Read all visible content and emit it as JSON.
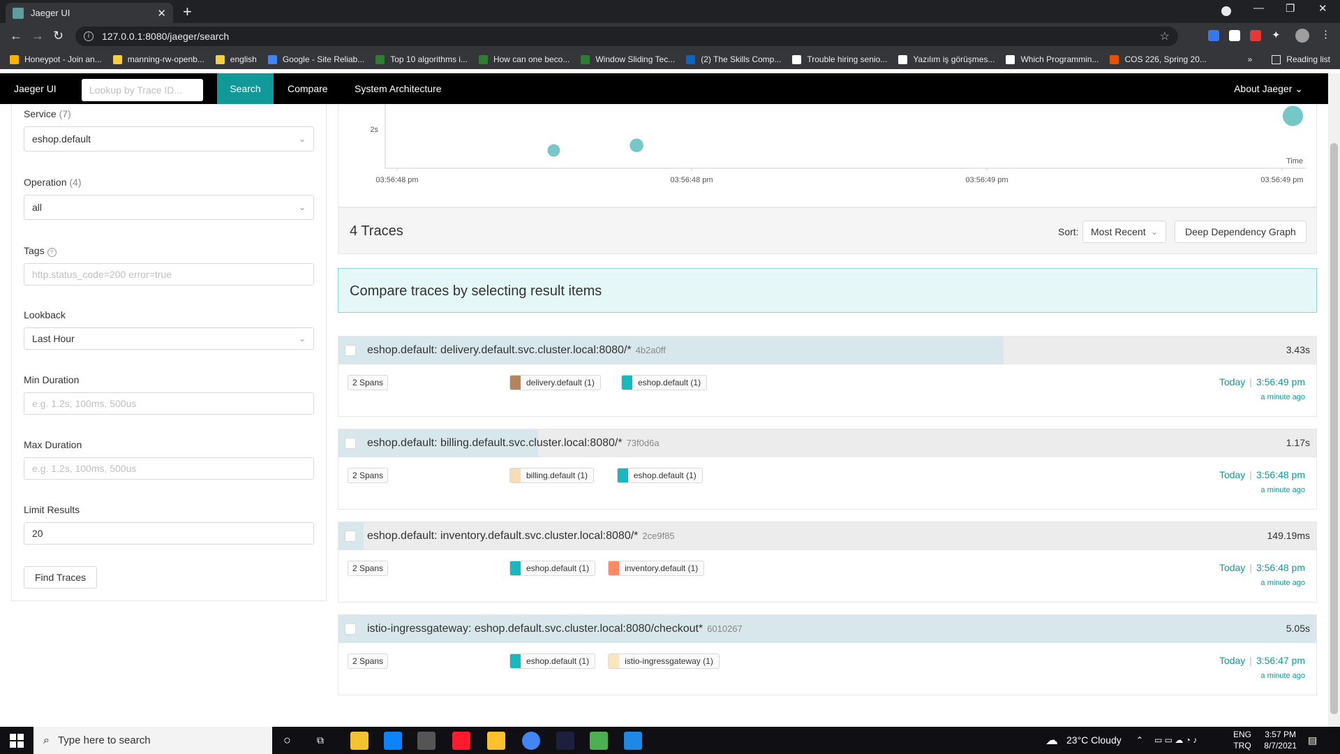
{
  "browser": {
    "tab_title": "Jaeger UI",
    "tab_close": "✕",
    "new_tab": "+",
    "url": "127.0.0.1:8080/jaeger/search",
    "window_controls": [
      "—",
      "❐",
      "✕"
    ],
    "bookmarks": [
      {
        "label": "Honeypot - Join an...",
        "color": "#f4b400"
      },
      {
        "label": "manning-rw-openb...",
        "color": "#f4d03f"
      },
      {
        "label": "english",
        "color": "#f4d03f"
      },
      {
        "label": "Google - Site Reliab...",
        "color": "#4285f4"
      },
      {
        "label": "Top 10 algorithms i...",
        "color": "#2e7d32"
      },
      {
        "label": "How can one beco...",
        "color": "#2e7d32"
      },
      {
        "label": "Window Sliding Tec...",
        "color": "#2e7d32"
      },
      {
        "label": "(2) The Skills Comp...",
        "color": "#0a66c2"
      },
      {
        "label": "Trouble hiring senio...",
        "color": "#ffffff"
      },
      {
        "label": "Yazılım iş görüşmes...",
        "color": "#ffffff"
      },
      {
        "label": "Which Programmin...",
        "color": "#ffffff"
      },
      {
        "label": "COS 226, Spring 20...",
        "color": "#e65100"
      }
    ],
    "bookmarks_more": "»",
    "reading_list": "Reading list"
  },
  "jaeger_nav": {
    "brand": "Jaeger UI",
    "lookup_placeholder": "Lookup by Trace ID...",
    "items": [
      "Search",
      "Compare",
      "System Architecture"
    ],
    "about": "About Jaeger ⌄"
  },
  "search_form": {
    "service_label": "Service",
    "service_count": "(7)",
    "service_value": "eshop.default",
    "operation_label": "Operation",
    "operation_count": "(4)",
    "operation_value": "all",
    "tags_label": "Tags",
    "tags_placeholder": "http.status_code=200 error=true",
    "lookback_label": "Lookback",
    "lookback_value": "Last Hour",
    "min_duration_label": "Min Duration",
    "min_duration_placeholder": "e.g. 1.2s, 100ms, 500us",
    "max_duration_label": "Max Duration",
    "max_duration_placeholder": "e.g. 1.2s, 100ms, 500us",
    "limit_label": "Limit Results",
    "limit_value": "20",
    "find_button": "Find Traces"
  },
  "chart_data": {
    "type": "scatter",
    "ytick": "2s",
    "xlabel": "Time",
    "x_ticks": [
      "03:56:48 pm",
      "03:56:48 pm",
      "03:56:49 pm",
      "03:56:49 pm"
    ],
    "points": [
      {
        "x": 0.183,
        "y": 1.17
      },
      {
        "x": 0.273,
        "y": 1.5
      },
      {
        "x": 0.986,
        "y": 3.43
      }
    ],
    "point_color": "#76c7c8"
  },
  "results": {
    "title": "4 Traces",
    "sort_label": "Sort:",
    "sort_value": "Most Recent",
    "ddg_button": "Deep Dependency Graph",
    "compare_message": "Compare traces by selecting result items"
  },
  "traces": [
    {
      "name": "eshop.default: delivery.default.svc.cluster.local:8080/*",
      "id": "4b2a0ff",
      "duration": "3.43s",
      "bar_fraction": 0.68,
      "spans": "2 Spans",
      "services": [
        {
          "label": "delivery.default (1)",
          "color": "#b5845a"
        },
        {
          "label": "eshop.default (1)",
          "color": "#17b8be"
        }
      ],
      "date": "Today",
      "time": "3:56:49 pm",
      "ago": "a minute ago"
    },
    {
      "name": "eshop.default: billing.default.svc.cluster.local:8080/*",
      "id": "73f0d6a",
      "duration": "1.17s",
      "bar_fraction": 0.204,
      "spans": "2 Spans",
      "services": [
        {
          "label": "billing.default (1)",
          "color": "#f8dcb5"
        },
        {
          "label": "eshop.default (1)",
          "color": "#17b8be"
        }
      ],
      "date": "Today",
      "time": "3:56:48 pm",
      "ago": "a minute ago"
    },
    {
      "name": "eshop.default: inventory.default.svc.cluster.local:8080/*",
      "id": "2ce9f85",
      "duration": "149.19ms",
      "bar_fraction": 0.026,
      "spans": "2 Spans",
      "services": [
        {
          "label": "eshop.default (1)",
          "color": "#17b8be"
        },
        {
          "label": "inventory.default (1)",
          "color": "#ff8a65"
        }
      ],
      "date": "Today",
      "time": "3:56:48 pm",
      "ago": "a minute ago"
    },
    {
      "name": "istio-ingressgateway: eshop.default.svc.cluster.local:8080/checkout*",
      "id": "6010267",
      "duration": "5.05s",
      "bar_fraction": 1.0,
      "spans": "2 Spans",
      "services": [
        {
          "label": "eshop.default (1)",
          "color": "#17b8be"
        },
        {
          "label": "istio-ingressgateway (1)",
          "color": "#f8e6c1"
        }
      ],
      "date": "Today",
      "time": "3:56:47 pm",
      "ago": "a minute ago"
    }
  ],
  "taskbar": {
    "search_placeholder": "Type here to search",
    "weather": "23°C  Cloudy",
    "lang_top": "ENG",
    "lang_bottom": "TRQ",
    "time": "3:57 PM",
    "date": "8/7/2021",
    "app_colors": [
      "#f4c430",
      "#0a84ff",
      "#555555",
      "#ff1b2d",
      "#fbc02d",
      "#4285f4",
      "#1e1e3f",
      "#4caf50",
      "#1e88e5"
    ]
  }
}
